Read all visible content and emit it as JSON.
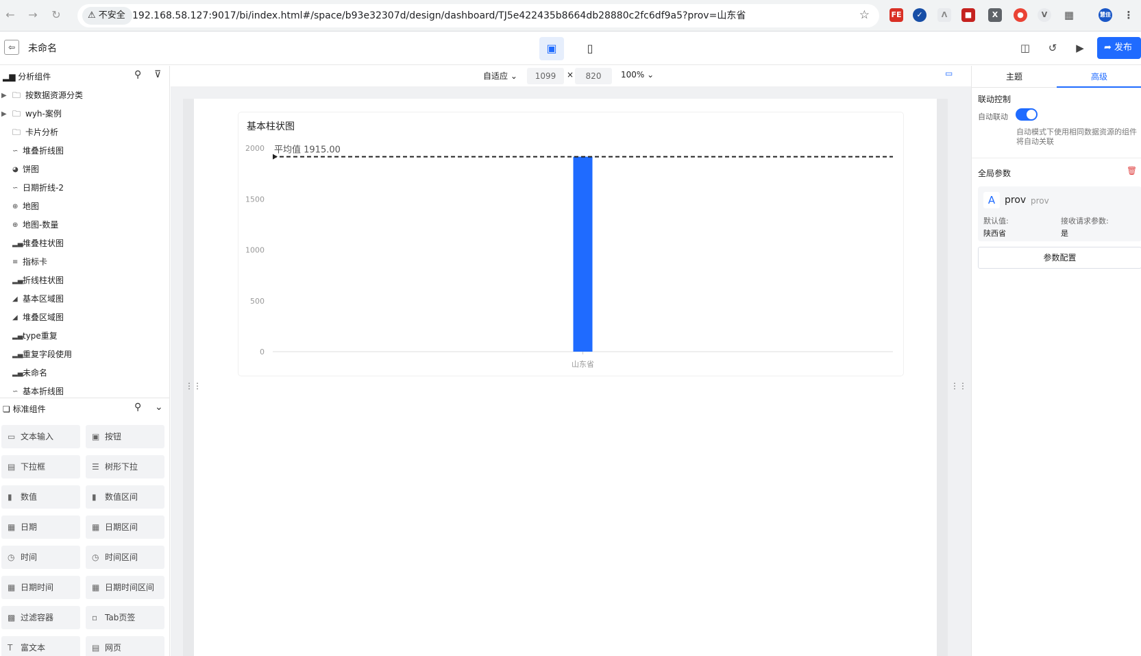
{
  "browser": {
    "security_label": "不安全",
    "url": "192.168.58.127:9017/bi/index.html#/space/b93e32307d/design/dashboard/TJ5e422435b8664db28880c2fc6df9a5?prov=山东省",
    "profile_label": "慧佳"
  },
  "header": {
    "title": "未命名",
    "publish_label": "发布"
  },
  "analysis_panel": {
    "title": "分析组件",
    "items": [
      {
        "label": "按数据资源分类",
        "icon": "folder-icon"
      },
      {
        "label": "wyh-案例",
        "icon": "folder-icon"
      },
      {
        "label": "卡片分析",
        "icon": "folder-icon"
      },
      {
        "label": "堆叠折线图",
        "icon": "line-chart-icon"
      },
      {
        "label": "饼图",
        "icon": "pie-chart-icon"
      },
      {
        "label": "日期折线-2",
        "icon": "line-chart-icon"
      },
      {
        "label": "地图",
        "icon": "globe-icon"
      },
      {
        "label": "地图-数量",
        "icon": "globe-icon"
      },
      {
        "label": "堆叠柱状图",
        "icon": "bar-chart-icon"
      },
      {
        "label": "指标卡",
        "icon": "metric-card-icon"
      },
      {
        "label": "折线柱状图",
        "icon": "bar-chart-icon"
      },
      {
        "label": "基本区域图",
        "icon": "area-chart-icon"
      },
      {
        "label": "堆叠区域图",
        "icon": "area-chart-icon"
      },
      {
        "label": "type重复",
        "icon": "bar-chart-icon"
      },
      {
        "label": "重复字段使用",
        "icon": "bar-chart-icon"
      },
      {
        "label": "未命名",
        "icon": "bar-chart-icon"
      },
      {
        "label": "基本折线图",
        "icon": "line-chart-icon"
      }
    ]
  },
  "standard_panel": {
    "title": "标准组件",
    "items": [
      {
        "label": "文本输入",
        "icon": "text-input-icon"
      },
      {
        "label": "按钮",
        "icon": "button-icon"
      },
      {
        "label": "下拉框",
        "icon": "dropdown-icon"
      },
      {
        "label": "树形下拉",
        "icon": "tree-dropdown-icon"
      },
      {
        "label": "数值",
        "icon": "number-icon"
      },
      {
        "label": "数值区间",
        "icon": "number-range-icon"
      },
      {
        "label": "日期",
        "icon": "calendar-icon"
      },
      {
        "label": "日期区间",
        "icon": "calendar-range-icon"
      },
      {
        "label": "时间",
        "icon": "clock-icon"
      },
      {
        "label": "时间区间",
        "icon": "clock-range-icon"
      },
      {
        "label": "日期时间",
        "icon": "datetime-icon"
      },
      {
        "label": "日期时间区间",
        "icon": "datetime-range-icon"
      },
      {
        "label": "过滤容器",
        "icon": "filter-container-icon"
      },
      {
        "label": "Tab页签",
        "icon": "tab-icon"
      },
      {
        "label": "富文本",
        "icon": "rich-text-icon"
      },
      {
        "label": "网页",
        "icon": "webpage-icon"
      }
    ]
  },
  "canvas_toolbar": {
    "fit_mode": "自适应",
    "width": "1099",
    "height": "820",
    "times": "×",
    "zoom": "100%"
  },
  "chart_data": {
    "type": "bar",
    "title": "基本柱状图",
    "categories": [
      "山东省"
    ],
    "values": [
      1915
    ],
    "ylim": [
      0,
      2000
    ],
    "yticks": [
      "0",
      "500",
      "1000",
      "1500",
      "2000"
    ],
    "avg_line": {
      "label": "平均值 1915.00",
      "value": 1915
    },
    "bar_color": "#1f6bff",
    "grid": false
  },
  "right_panel": {
    "tabs": [
      "主题",
      "高级"
    ],
    "active_tab": "高级",
    "link_control": {
      "title": "联动控制",
      "auto_label": "自动联动",
      "auto_enabled": true,
      "hint": "自动模式下使用相同数据资源的组件将自动关联"
    },
    "global_params": {
      "title": "全局参数",
      "param": {
        "icon_letter": "A",
        "name": "prov",
        "key": "prov",
        "default_label": "默认值:",
        "default_value": "陕西省",
        "receive_label": "接收请求参数:",
        "receive_value": "是"
      },
      "config_button": "参数配置"
    }
  },
  "colors": {
    "accent": "#1f6bff",
    "danger": "#e04444"
  }
}
